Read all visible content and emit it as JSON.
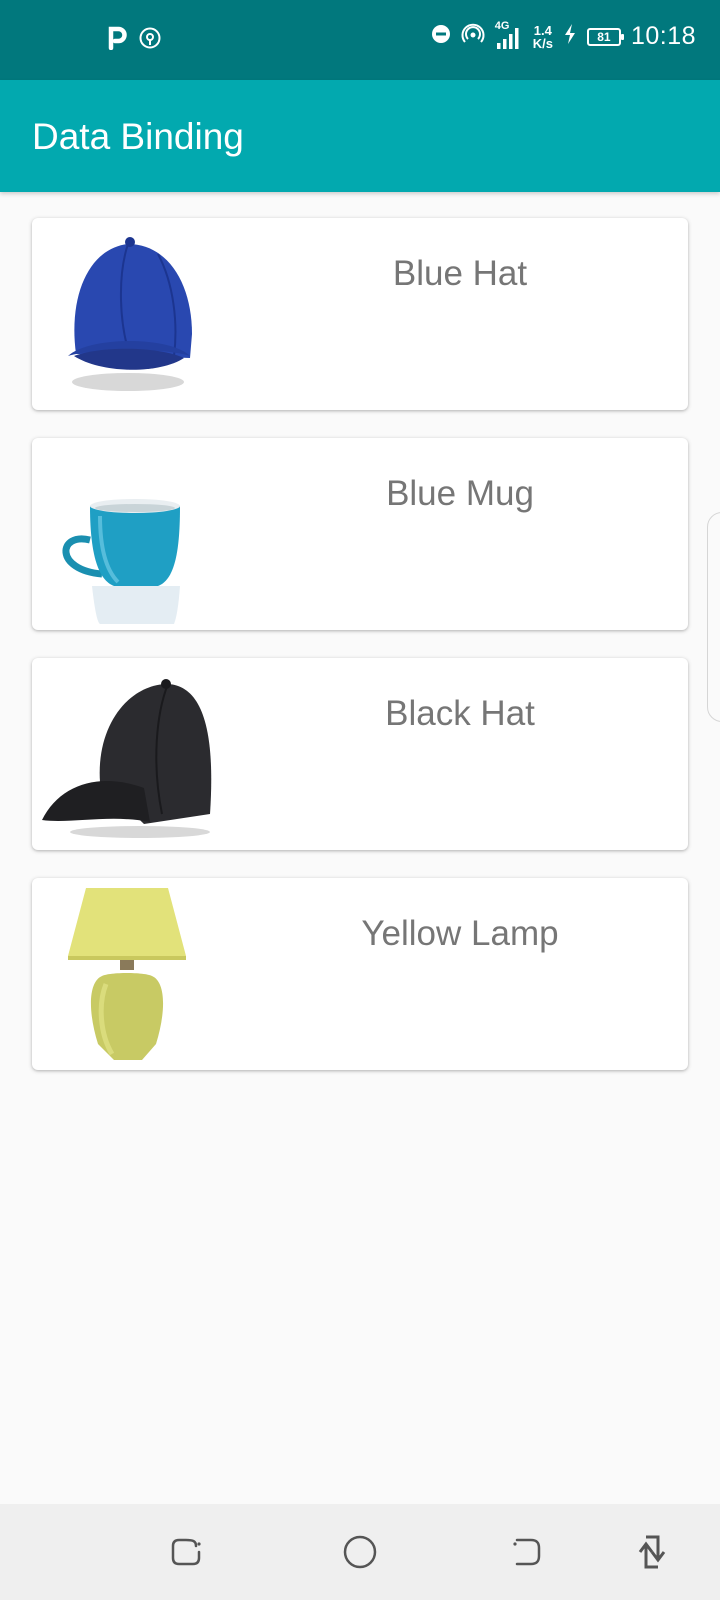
{
  "status_bar": {
    "time": "10:18",
    "network_type": "4G",
    "speed_value": "1.4",
    "speed_unit": "K/s",
    "battery_level": "81",
    "left_icons": [
      "parking-app-icon",
      "location-tracking-icon"
    ],
    "right_icons": [
      "do-not-disturb-icon",
      "hotspot-icon",
      "signal-strength-icon",
      "charging-icon",
      "battery-icon"
    ]
  },
  "app_bar": {
    "title": "Data Binding",
    "background_color": "#02a9af",
    "status_color": "#01787d"
  },
  "products": [
    {
      "name": "Blue Hat",
      "image": "blue-hat-image"
    },
    {
      "name": "Blue Mug",
      "image": "blue-mug-image"
    },
    {
      "name": "Black Hat",
      "image": "black-hat-image"
    },
    {
      "name": "Yellow Lamp",
      "image": "yellow-lamp-image"
    }
  ],
  "nav_bar": {
    "buttons": [
      "recent-apps-icon",
      "home-icon",
      "back-icon",
      "rotate-screen-icon"
    ]
  }
}
